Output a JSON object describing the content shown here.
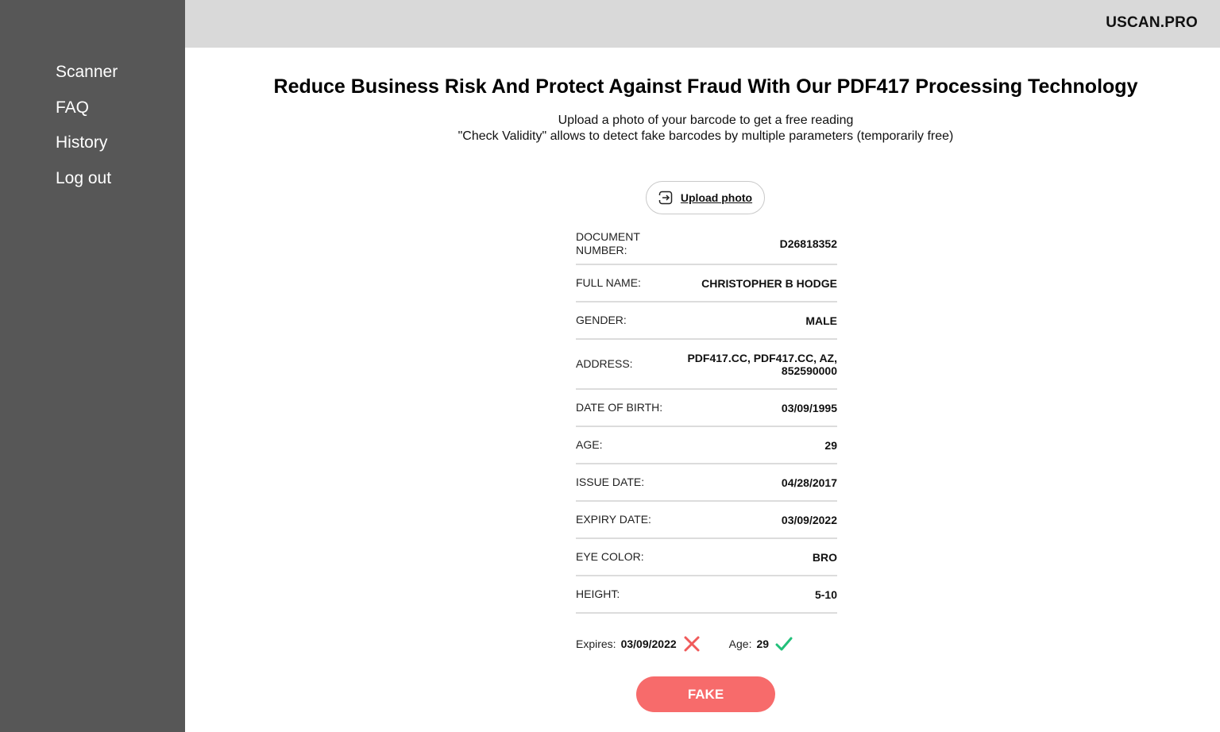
{
  "sidebar": {
    "items": [
      {
        "label": "Scanner"
      },
      {
        "label": "FAQ"
      },
      {
        "label": "History"
      },
      {
        "label": "Log out"
      }
    ]
  },
  "header": {
    "brand": "USCAN.PRO"
  },
  "main": {
    "headline": "Reduce Business Risk And Protect Against Fraud With Our PDF417 Processing Technology",
    "subtitle_line1": "Upload a photo of your barcode to get a free reading",
    "subtitle_line2": "\"Check Validity\" allows to detect fake barcodes by multiple parameters (temporarily free)",
    "upload_label": "Upload photo",
    "fields": [
      {
        "label": "DOCUMENT NUMBER:",
        "value": "D26818352"
      },
      {
        "label": "FULL NAME:",
        "value": "CHRISTOPHER B HODGE"
      },
      {
        "label": "GENDER:",
        "value": "MALE"
      },
      {
        "label": "ADDRESS:",
        "value": "PDF417.CC, PDF417.CC, AZ, 852590000"
      },
      {
        "label": "DATE OF BIRTH:",
        "value": "03/09/1995"
      },
      {
        "label": "AGE:",
        "value": "29"
      },
      {
        "label": "ISSUE DATE:",
        "value": "04/28/2017"
      },
      {
        "label": "EXPIRY DATE:",
        "value": "03/09/2022"
      },
      {
        "label": "EYE COLOR:",
        "value": "BRO"
      },
      {
        "label": "HEIGHT:",
        "value": "5-10"
      }
    ],
    "checks": {
      "expires_label": "Expires:",
      "expires_value": "03/09/2022",
      "expires_status_icon": "x-icon",
      "expires_status_color": "#f05a5a",
      "age_label": "Age:",
      "age_value": "29",
      "age_status_icon": "checkmark-icon",
      "age_status_color": "#22c07a"
    },
    "result_label": "FAKE",
    "result_color": "#f76b6b"
  }
}
